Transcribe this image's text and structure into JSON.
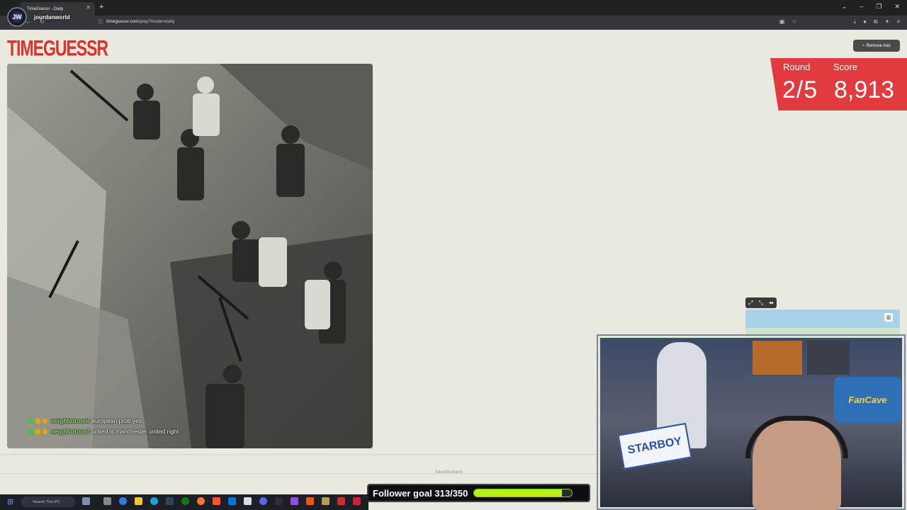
{
  "browser": {
    "tab_title": "TimeGuessr - Daily",
    "url_host": "timeguessr.com",
    "url_path": "/play?mode=daily",
    "new_tab_label": "+"
  },
  "stream": {
    "channel": "jourdanworld",
    "avatar_text": "JW",
    "chat": [
      {
        "user": "neighborooni",
        "message": "european prob yes"
      },
      {
        "user": "neighborooni",
        "message": "united is manchester united right"
      }
    ],
    "follower_goal": {
      "label": "Follower goal 313/350",
      "current": 313,
      "target": 350
    },
    "cam_poster_text": "FanCave",
    "cam_plate_text": "STARBOY"
  },
  "site": {
    "logo": "TIMEGUESSR",
    "remove_ads_label": "Remove Ads",
    "round_label": "Round",
    "round_value": "2/5",
    "score_label": "Score",
    "score_value": "8,913",
    "advertisement_label": "Advertisement",
    "photo_alt": "Black and white photograph of workers digging with pickaxes"
  },
  "taskbar": {
    "search_placeholder": "Search This PC"
  },
  "colors": {
    "accent_red": "#e13b3f",
    "page_bg": "#e9e9e0",
    "goal_fill": "#b8f01a"
  }
}
